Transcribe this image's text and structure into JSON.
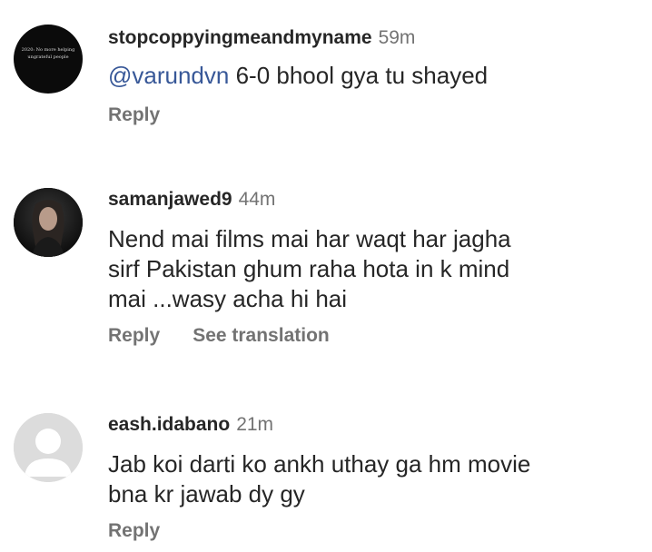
{
  "comments": [
    {
      "username": "stopcoppyingmeandmyname",
      "time": "59m",
      "mention": "@varundvn",
      "text": " 6-0 bhool gya tu shayed",
      "avatar_text": "2020: No more helping ungrateful people",
      "actions": {
        "reply": "Reply"
      }
    },
    {
      "username": "samanjawed9",
      "time": "44m",
      "lines": [
        "Nend mai films mai har waqt har jagha",
        "sirf Pakistan ghum raha hota in k mind",
        "mai ...wasy acha hi hai"
      ],
      "actions": {
        "reply": "Reply",
        "translate": "See translation"
      }
    },
    {
      "username": "eash.idabano",
      "time": "21m",
      "lines": [
        "Jab koi darti ko ankh uthay ga hm movie",
        "bna kr jawab dy gy"
      ],
      "actions": {
        "reply": "Reply"
      }
    }
  ]
}
